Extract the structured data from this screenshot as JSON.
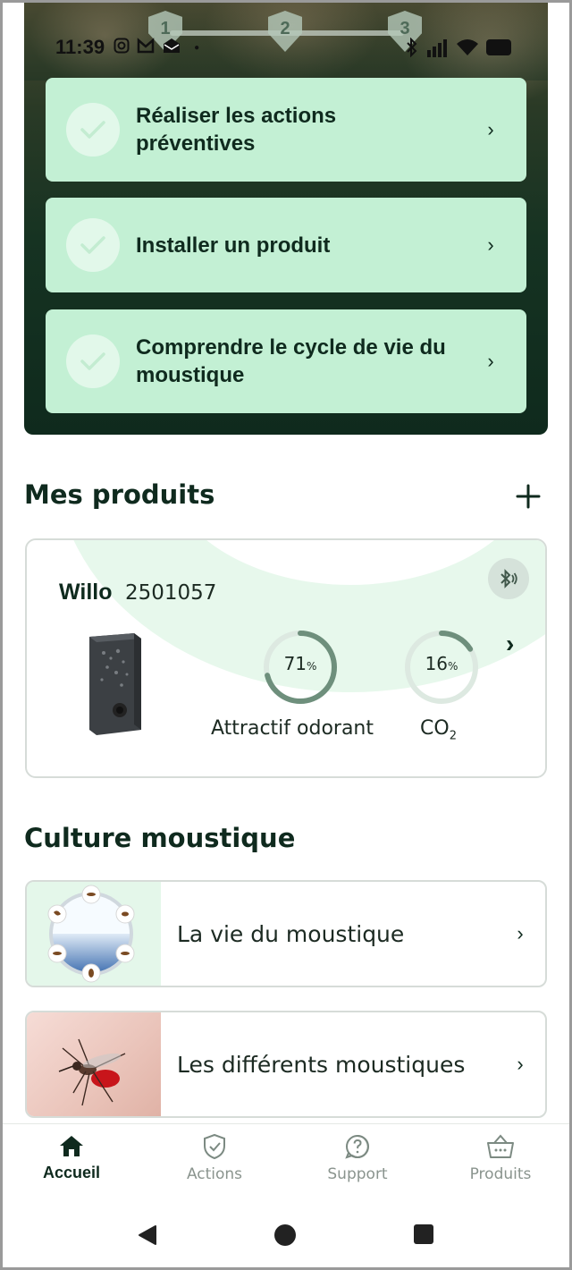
{
  "status_bar": {
    "time": "11:39",
    "notification_icons": [
      "instagram-icon",
      "gmail-icon",
      "mail-icon"
    ],
    "system_icons": [
      "bluetooth-icon",
      "signal-icon",
      "wifi-icon",
      "battery-icon"
    ]
  },
  "progress_steps": [
    "1",
    "2",
    "3"
  ],
  "actions": [
    {
      "label": "Réaliser les actions préventives",
      "icon": "check-icon"
    },
    {
      "label": "Installer un produit",
      "icon": "check-icon"
    },
    {
      "label": "Comprendre le cycle de vie du moustique",
      "icon": "check-icon"
    }
  ],
  "products_section": {
    "title": "Mes produits",
    "add_icon": "plus-icon"
  },
  "product": {
    "name": "Willo",
    "serial": "2501057",
    "gauges": [
      {
        "value": "71",
        "unit": "%",
        "fraction": 0.71,
        "label": "Attractif odorant"
      },
      {
        "value": "16",
        "unit": "%",
        "fraction": 0.16,
        "label": "CO",
        "label_sub": "2"
      }
    ]
  },
  "culture_section": {
    "title": "Culture moustique",
    "items": [
      {
        "label": "La vie du moustique",
        "thumb": "mosquito-lifecycle"
      },
      {
        "label": "Les différents moustiques",
        "thumb": "mosquito-on-skin"
      }
    ]
  },
  "bottom_nav": [
    {
      "label": "Accueil",
      "icon": "home-icon",
      "active": true
    },
    {
      "label": "Actions",
      "icon": "shield-check-icon",
      "active": false
    },
    {
      "label": "Support",
      "icon": "help-icon",
      "active": false
    },
    {
      "label": "Produits",
      "icon": "basket-icon",
      "active": false
    }
  ],
  "colors": {
    "primary_dark": "#0f2a1e",
    "card_green": "#c3f0d4",
    "gauge_dark": "#6e8f7c",
    "gauge_light": "#dde9e1"
  }
}
